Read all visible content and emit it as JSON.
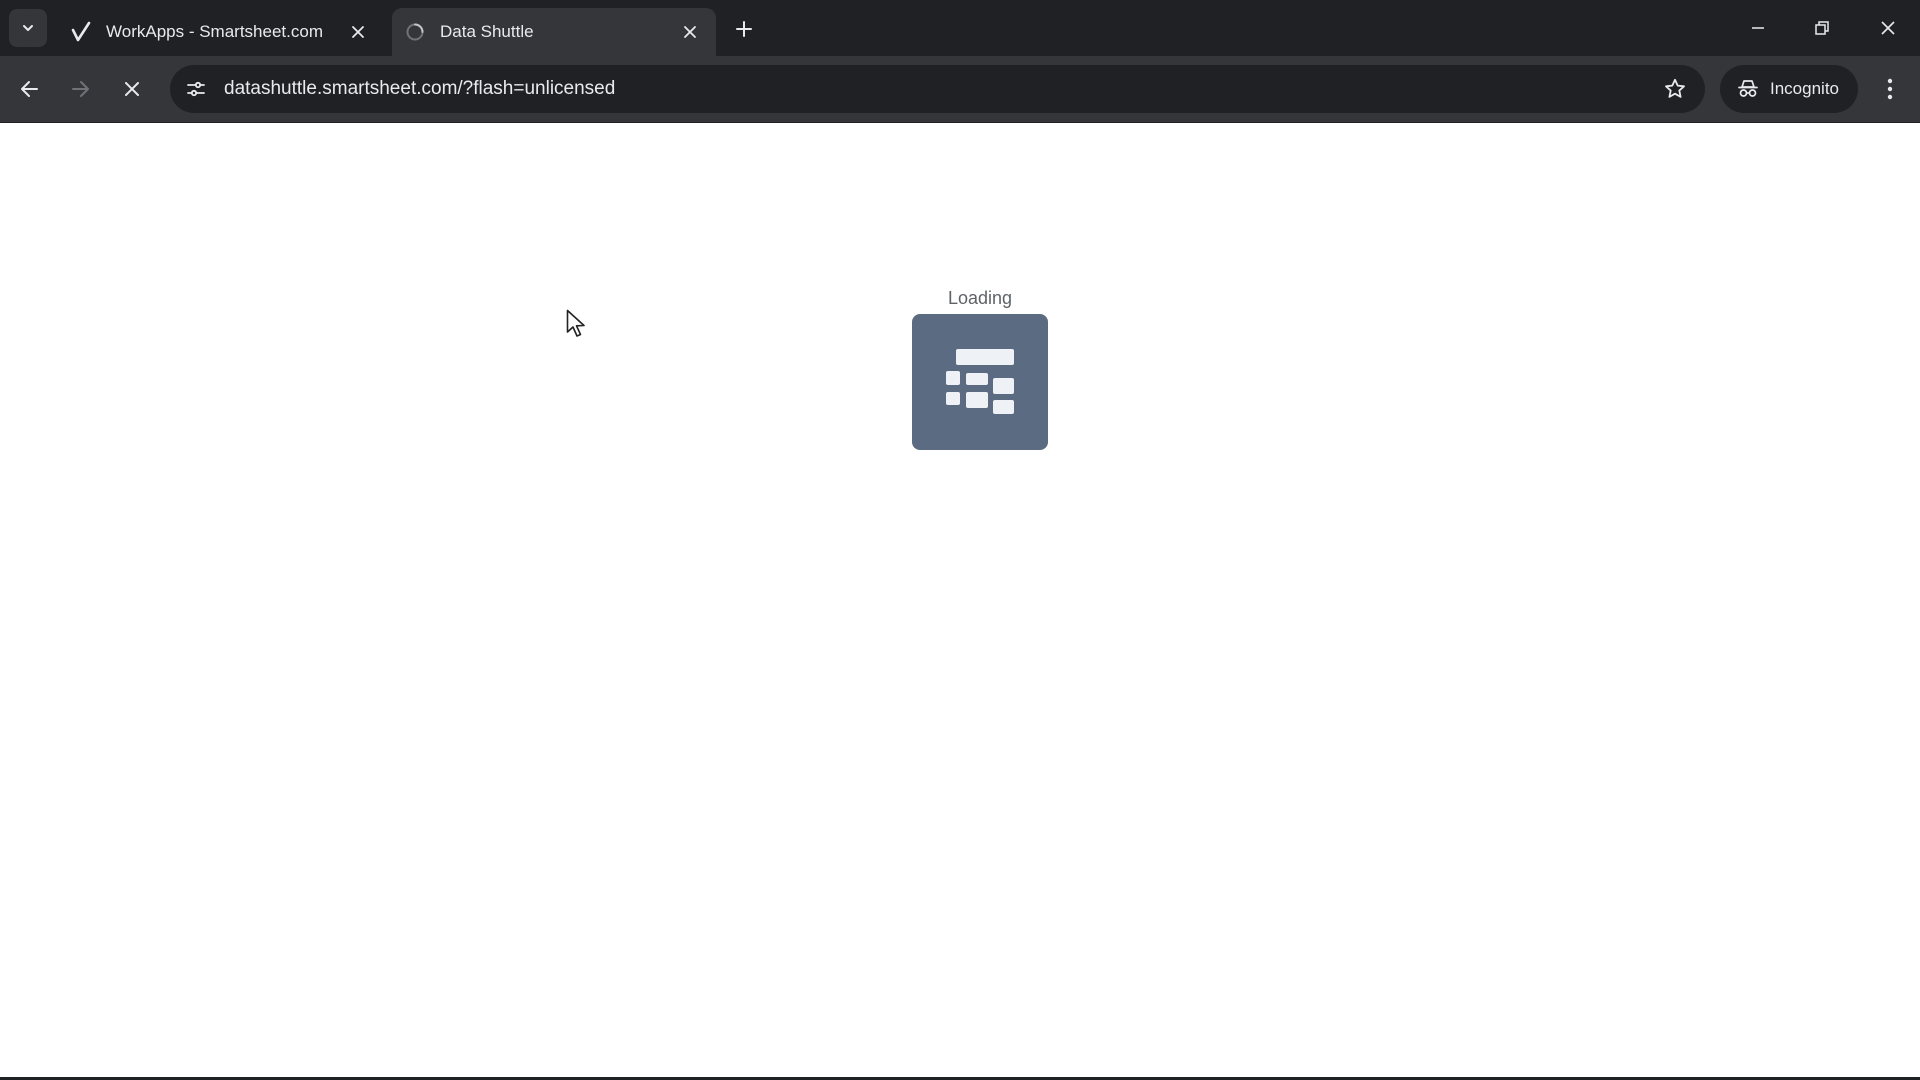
{
  "tabs": [
    {
      "title": "WorkApps - Smartsheet.com",
      "favicon": "smartsheet-check-icon",
      "active": false
    },
    {
      "title": "Data Shuttle",
      "favicon": "loading-spinner-icon",
      "active": true
    }
  ],
  "toolbar": {
    "url": "datashuttle.smartsheet.com/?flash=unlicensed",
    "incognito_label": "Incognito"
  },
  "page": {
    "loading_text": "Loading",
    "logo_icon": "data-shuttle-logo-icon"
  },
  "colors": {
    "frame_dark": "#202124",
    "toolbar": "#35363a",
    "logo_bg": "#5b6b82",
    "text_light": "#e8eaed"
  }
}
